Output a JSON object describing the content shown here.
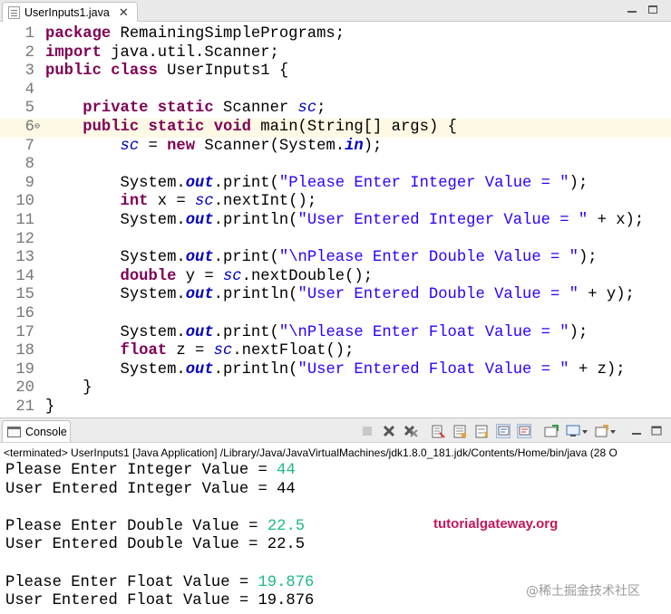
{
  "editor_tab": {
    "title": "UserInputs1.java",
    "close_glyph": "✕"
  },
  "code_lines": [
    {
      "num": "1",
      "tokens": [
        [
          "kw",
          "package"
        ],
        [
          "id",
          " RemainingSimplePrograms;"
        ]
      ]
    },
    {
      "num": "2",
      "tokens": [
        [
          "kw",
          "import"
        ],
        [
          "id",
          " java.util.Scanner;"
        ]
      ]
    },
    {
      "num": "3",
      "tokens": [
        [
          "kw",
          "public"
        ],
        [
          "id",
          " "
        ],
        [
          "kw",
          "class"
        ],
        [
          "id",
          " UserInputs1 {"
        ]
      ]
    },
    {
      "num": "4",
      "tokens": []
    },
    {
      "num": "5",
      "tokens": [
        [
          "id",
          "    "
        ],
        [
          "kw",
          "private"
        ],
        [
          "id",
          " "
        ],
        [
          "kw",
          "static"
        ],
        [
          "id",
          " Scanner "
        ],
        [
          "fld",
          "sc"
        ],
        [
          "id",
          ";"
        ]
      ]
    },
    {
      "num": "6",
      "fold": "⊖",
      "current": true,
      "tokens": [
        [
          "id",
          "    "
        ],
        [
          "kw",
          "public"
        ],
        [
          "id",
          " "
        ],
        [
          "kw",
          "static"
        ],
        [
          "id",
          " "
        ],
        [
          "kw",
          "void"
        ],
        [
          "id",
          " main(String[] args) {"
        ]
      ]
    },
    {
      "num": "7",
      "tokens": [
        [
          "id",
          "        "
        ],
        [
          "fld",
          "sc"
        ],
        [
          "id",
          " = "
        ],
        [
          "kw",
          "new"
        ],
        [
          "id",
          " Scanner(System."
        ],
        [
          "sfld",
          "in"
        ],
        [
          "id",
          ");"
        ]
      ]
    },
    {
      "num": "8",
      "tokens": []
    },
    {
      "num": "9",
      "tokens": [
        [
          "id",
          "        System."
        ],
        [
          "sfld",
          "out"
        ],
        [
          "id",
          ".print("
        ],
        [
          "str",
          "\"Please Enter Integer Value = \""
        ],
        [
          "id",
          ");"
        ]
      ]
    },
    {
      "num": "10",
      "tokens": [
        [
          "id",
          "        "
        ],
        [
          "kw",
          "int"
        ],
        [
          "id",
          " x = "
        ],
        [
          "fld",
          "sc"
        ],
        [
          "id",
          ".nextInt();"
        ]
      ]
    },
    {
      "num": "11",
      "tokens": [
        [
          "id",
          "        System."
        ],
        [
          "sfld",
          "out"
        ],
        [
          "id",
          ".println("
        ],
        [
          "str",
          "\"User Entered Integer Value = \""
        ],
        [
          "id",
          " + x);"
        ]
      ]
    },
    {
      "num": "12",
      "tokens": []
    },
    {
      "num": "13",
      "tokens": [
        [
          "id",
          "        System."
        ],
        [
          "sfld",
          "out"
        ],
        [
          "id",
          ".print("
        ],
        [
          "str",
          "\"\\nPlease Enter Double Value = \""
        ],
        [
          "id",
          ");"
        ]
      ]
    },
    {
      "num": "14",
      "tokens": [
        [
          "id",
          "        "
        ],
        [
          "kw",
          "double"
        ],
        [
          "id",
          " y = "
        ],
        [
          "fld",
          "sc"
        ],
        [
          "id",
          ".nextDouble();"
        ]
      ]
    },
    {
      "num": "15",
      "tokens": [
        [
          "id",
          "        System."
        ],
        [
          "sfld",
          "out"
        ],
        [
          "id",
          ".println("
        ],
        [
          "str",
          "\"User Entered Double Value = \""
        ],
        [
          "id",
          " + y);"
        ]
      ]
    },
    {
      "num": "16",
      "tokens": []
    },
    {
      "num": "17",
      "tokens": [
        [
          "id",
          "        System."
        ],
        [
          "sfld",
          "out"
        ],
        [
          "id",
          ".print("
        ],
        [
          "str",
          "\"\\nPlease Enter Float Value = \""
        ],
        [
          "id",
          ");"
        ]
      ]
    },
    {
      "num": "18",
      "tokens": [
        [
          "id",
          "        "
        ],
        [
          "kw",
          "float"
        ],
        [
          "id",
          " z = "
        ],
        [
          "fld",
          "sc"
        ],
        [
          "id",
          ".nextFloat();"
        ]
      ]
    },
    {
      "num": "19",
      "tokens": [
        [
          "id",
          "        System."
        ],
        [
          "sfld",
          "out"
        ],
        [
          "id",
          ".println("
        ],
        [
          "str",
          "\"User Entered Float Value = \""
        ],
        [
          "id",
          " + z);"
        ]
      ]
    },
    {
      "num": "20",
      "tokens": [
        [
          "id",
          "    }"
        ]
      ]
    },
    {
      "num": "21",
      "tokens": [
        [
          "id",
          "}"
        ]
      ]
    }
  ],
  "console": {
    "tab_label": "Console",
    "terminated_text": "<terminated> UserInputs1 [Java Application] /Library/Java/JavaVirtualMachines/jdk1.8.0_181.jdk/Contents/Home/bin/java  (28 O",
    "output_lines": [
      {
        "text": "Please Enter Integer Value = ",
        "input": "44"
      },
      {
        "text": "User Entered Integer Value = 44",
        "input": ""
      },
      {
        "text": "",
        "input": ""
      },
      {
        "text": "Please Enter Double Value = ",
        "input": "22.5"
      },
      {
        "text": "User Entered Double Value = 22.5",
        "input": ""
      },
      {
        "text": "",
        "input": ""
      },
      {
        "text": "Please Enter Float Value = ",
        "input": "19.876"
      },
      {
        "text": "User Entered Float Value = 19.876",
        "input": ""
      }
    ],
    "toolbar_icons": [
      "terminate-icon",
      "remove-launch-icon",
      "remove-all-terminated-icon",
      "clear-console-icon",
      "scroll-lock-icon",
      "word-wrap-icon",
      "show-on-stdout-icon",
      "show-on-stderr-icon",
      "pin-console-icon",
      "display-console-icon",
      "open-console-icon"
    ]
  },
  "watermarks": {
    "site": "tutorialgateway.org",
    "community": "@稀土掘金技术社区"
  },
  "colors": {
    "keyword": "#7f0055",
    "string": "#2a00ff",
    "field": "#0000c0",
    "input": "#1db98a",
    "current_line": "#fdf9e5"
  }
}
